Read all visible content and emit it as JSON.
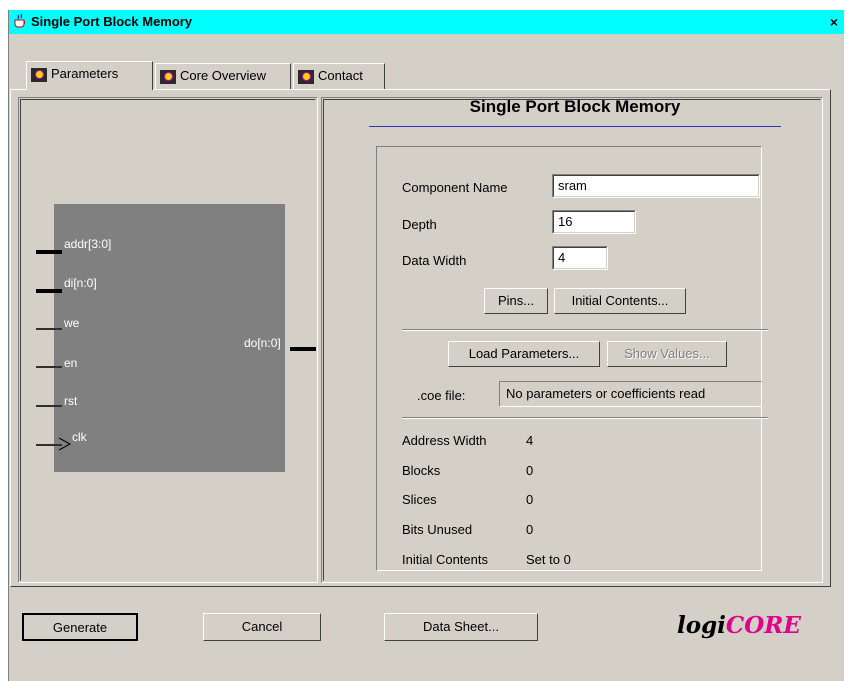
{
  "window": {
    "title": "Single Port Block Memory",
    "close_glyph": "×"
  },
  "tabs": [
    {
      "label": "Parameters",
      "icon": "core-icon"
    },
    {
      "label": "Core Overview",
      "icon": "core-icon"
    },
    {
      "label": "Contact",
      "icon": "core-icon"
    }
  ],
  "symbol": {
    "pins_in": [
      "addr[3:0]",
      "di[n:0]",
      "we",
      "en",
      "rst",
      "clk"
    ],
    "pin_out": "do[n:0]"
  },
  "form": {
    "title": "Single Port Block Memory",
    "component_name_label": "Component Name",
    "component_name_value": "sram",
    "depth_label": "Depth",
    "depth_value": "16",
    "data_width_label": "Data Width",
    "data_width_value": "4",
    "pins_button": "Pins...",
    "initial_contents_button": "Initial Contents...",
    "load_parameters_button": "Load Parameters...",
    "show_values_button": "Show Values...",
    "coe_label": ".coe file:",
    "coe_value": "No parameters or coefficients read",
    "info": [
      {
        "label": "Address Width",
        "value": "4"
      },
      {
        "label": "Blocks",
        "value": "0"
      },
      {
        "label": "Slices",
        "value": "0"
      },
      {
        "label": "Bits Unused",
        "value": "0"
      },
      {
        "label": "Initial Contents",
        "value": "Set to 0"
      }
    ]
  },
  "buttons": {
    "generate": "Generate",
    "cancel": "Cancel",
    "data_sheet": "Data Sheet..."
  },
  "logo": {
    "part1": "logi",
    "part2": "CORE"
  },
  "colors": {
    "titlebar": "#00ffff",
    "background": "#d4d0c8",
    "symbol": "#808080",
    "title_underline": "#3030c0",
    "logo_accent": "#e0008c"
  }
}
